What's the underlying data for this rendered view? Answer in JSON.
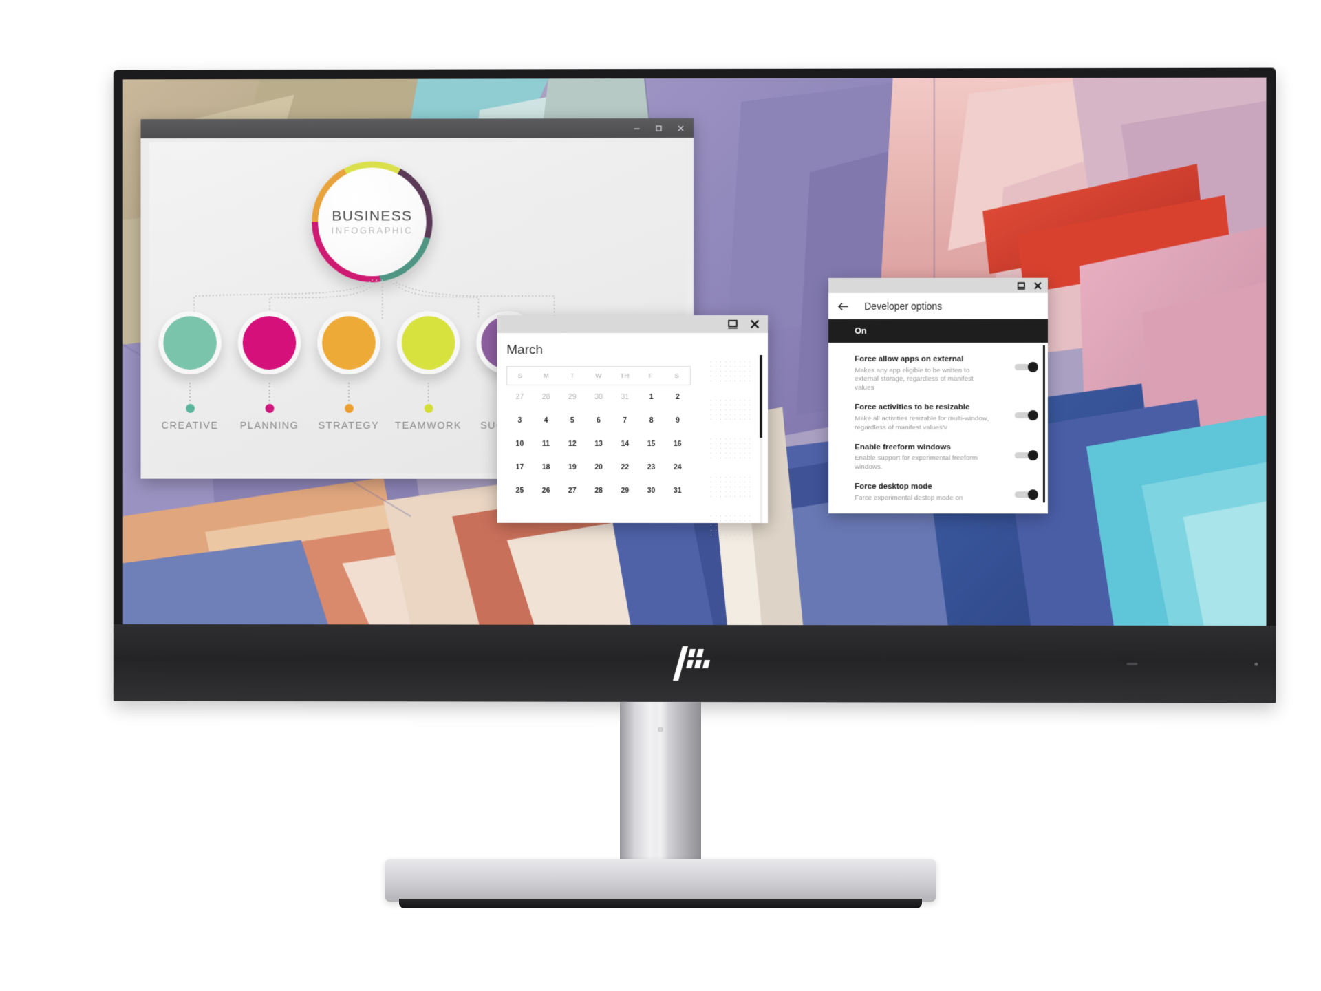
{
  "device": {
    "brand_logo": "hp-logo",
    "type": "monitor"
  },
  "desktop": {
    "wallpaper_name": "abstract-geometric-beams",
    "wallpaper_colors": [
      "#8d85b8",
      "#c9b3c9",
      "#e8a8a2",
      "#d94f3d",
      "#5fc5d8",
      "#3f5fa8",
      "#cfae6e",
      "#f0e2d0"
    ]
  },
  "windows": {
    "infographic": {
      "title": "",
      "controls": [
        "minimize",
        "maximize",
        "close"
      ],
      "hub": {
        "line1": "BUSINESS",
        "line2": "INFOGRAPHIC",
        "ring_colors": [
          "#cf1a72",
          "#e8a33d",
          "#d9e04a",
          "#5b3a57",
          "#4e9683"
        ]
      },
      "nodes": [
        {
          "label": "CREATIVE",
          "color": "#79c4ab"
        },
        {
          "label": "PLANNING",
          "color": "#d5107a"
        },
        {
          "label": "STRATEGY",
          "color": "#eeaa36"
        },
        {
          "label": "TEAMWORK",
          "color": "#d8e23f"
        },
        {
          "label": "SUCCESS",
          "color": "#8e5fa0"
        }
      ]
    },
    "calendar": {
      "month": "March",
      "controls": [
        "restore-down",
        "close"
      ],
      "weekday_headers": [
        "S",
        "M",
        "T",
        "W",
        "TH",
        "F",
        "S"
      ],
      "weeks": [
        [
          {
            "d": "27",
            "muted": true
          },
          {
            "d": "28",
            "muted": true
          },
          {
            "d": "29",
            "muted": true
          },
          {
            "d": "30",
            "muted": true
          },
          {
            "d": "31",
            "muted": true
          },
          {
            "d": "1",
            "muted": false
          },
          {
            "d": "2",
            "muted": false
          }
        ],
        [
          {
            "d": "3",
            "muted": false
          },
          {
            "d": "4",
            "muted": false
          },
          {
            "d": "5",
            "muted": false
          },
          {
            "d": "6",
            "muted": false
          },
          {
            "d": "7",
            "muted": false
          },
          {
            "d": "8",
            "muted": false
          },
          {
            "d": "9",
            "muted": false
          }
        ],
        [
          {
            "d": "10",
            "muted": false
          },
          {
            "d": "11",
            "muted": false
          },
          {
            "d": "12",
            "muted": false
          },
          {
            "d": "13",
            "muted": false
          },
          {
            "d": "14",
            "muted": false
          },
          {
            "d": "15",
            "muted": false
          },
          {
            "d": "16",
            "muted": false
          }
        ],
        [
          {
            "d": "17",
            "muted": false
          },
          {
            "d": "18",
            "muted": false
          },
          {
            "d": "19",
            "muted": false
          },
          {
            "d": "20",
            "muted": false
          },
          {
            "d": "22",
            "muted": false
          },
          {
            "d": "23",
            "muted": false
          },
          {
            "d": "24",
            "muted": false
          }
        ],
        [
          {
            "d": "25",
            "muted": false
          },
          {
            "d": "26",
            "muted": false
          },
          {
            "d": "27",
            "muted": false
          },
          {
            "d": "28",
            "muted": false
          },
          {
            "d": "29",
            "muted": false
          },
          {
            "d": "30",
            "muted": false
          },
          {
            "d": "31",
            "muted": false
          }
        ]
      ]
    },
    "developer_options": {
      "controls": [
        "restore-down",
        "close"
      ],
      "back_icon": "arrow-left-icon",
      "title": "Developer options",
      "master_state": "On",
      "items": [
        {
          "title": "Force allow apps on external",
          "description": "Makes any app eligible to be written to external storage, regardless of manifest values",
          "toggle": "on"
        },
        {
          "title": "Force activities to be resizable",
          "description": "Make all activities resizable for multi-window, regardless of manifest values'v",
          "toggle": "on"
        },
        {
          "title": "Enable freeform windows",
          "description": "Enable support for experimental freeform windows.",
          "toggle": "on"
        },
        {
          "title": "Force desktop mode",
          "description": "Force experimental destop mode on",
          "toggle": "on"
        }
      ]
    }
  }
}
